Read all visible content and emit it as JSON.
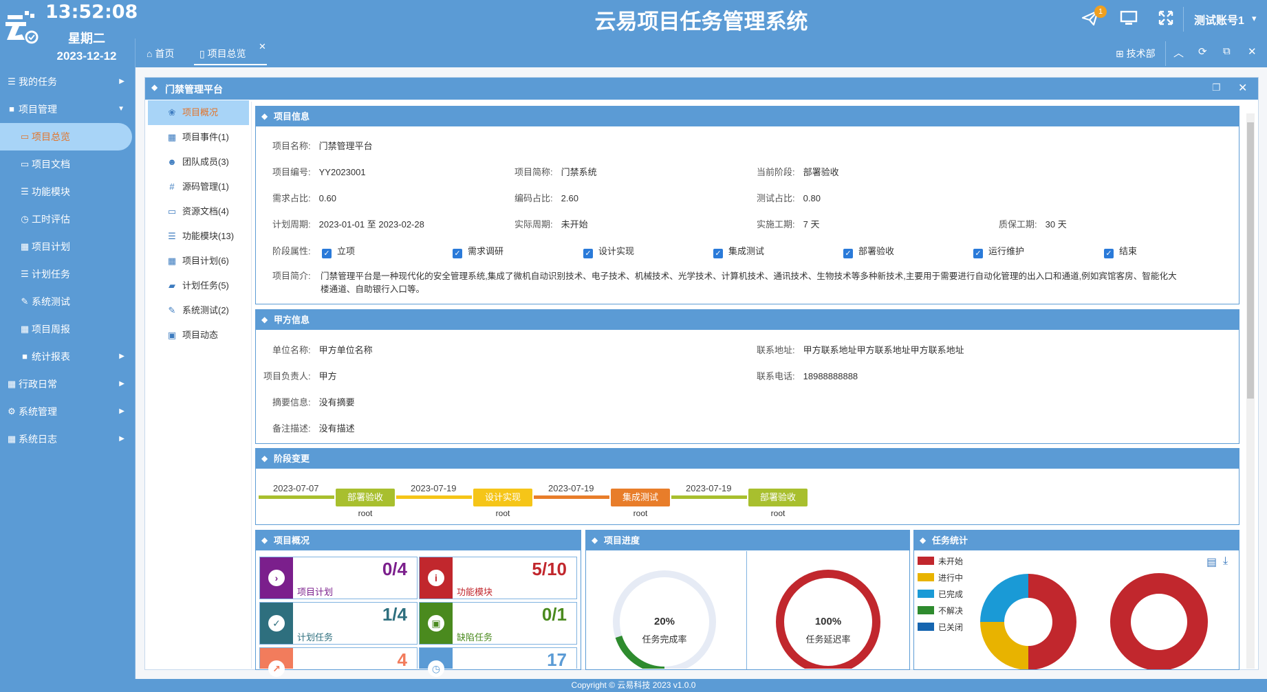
{
  "header": {
    "time": "13:52:08",
    "weekday": "星期二",
    "date": "2023-12-12",
    "title": "云易项目任务管理系统",
    "notification_count": "1",
    "account": "测试账号1"
  },
  "sidebar": {
    "items": [
      {
        "label": "我的任务",
        "icon": "list-icon"
      },
      {
        "label": "项目管理",
        "icon": "folder-icon"
      },
      {
        "label": "项目总览",
        "icon": "folder-open-icon"
      },
      {
        "label": "项目文档",
        "icon": "folder-open-icon"
      },
      {
        "label": "功能模块",
        "icon": "list-icon"
      },
      {
        "label": "工时评估",
        "icon": "clock-icon"
      },
      {
        "label": "项目计划",
        "icon": "calendar-icon"
      },
      {
        "label": "计划任务",
        "icon": "list-icon"
      },
      {
        "label": "系统测试",
        "icon": "pencil-icon"
      },
      {
        "label": "项目周报",
        "icon": "calendar-icon"
      },
      {
        "label": "统计报表",
        "icon": "folder-icon"
      },
      {
        "label": "行政日常",
        "icon": "calendar-check-icon"
      },
      {
        "label": "系统管理",
        "icon": "gears-icon"
      },
      {
        "label": "系统日志",
        "icon": "calendar-icon"
      }
    ]
  },
  "tabs": {
    "home": "首页",
    "overview": "项目总览",
    "department": "技术部"
  },
  "window": {
    "title": "门禁管理平台"
  },
  "inner_nav": [
    {
      "label": "项目概况",
      "icon": "paw-icon"
    },
    {
      "label": "项目事件(1)",
      "icon": "calendar-check-icon"
    },
    {
      "label": "团队成员(3)",
      "icon": "users-icon"
    },
    {
      "label": "源码管理(1)",
      "icon": "hash-icon"
    },
    {
      "label": "资源文档(4)",
      "icon": "folder-open-icon"
    },
    {
      "label": "功能模块(13)",
      "icon": "list-icon"
    },
    {
      "label": "项目计划(6)",
      "icon": "calendar-icon"
    },
    {
      "label": "计划任务(5)",
      "icon": "book-icon"
    },
    {
      "label": "系统测试(2)",
      "icon": "pencil-icon"
    },
    {
      "label": "项目动态",
      "icon": "contact-icon"
    }
  ],
  "project_info": {
    "heading": "项目信息",
    "name_label": "项目名称:",
    "name": "门禁管理平台",
    "code_label": "项目编号:",
    "code": "YY2023001",
    "short_label": "项目简称:",
    "short": "门禁系统",
    "stage_label": "当前阶段:",
    "stage": "部署验收",
    "req_label": "需求占比:",
    "req": "0.60",
    "dev_label": "编码占比:",
    "dev": "2.60",
    "test_label": "测试占比:",
    "test": "0.80",
    "plan_label": "计划周期:",
    "plan": "2023-01-01 至 2023-02-28",
    "actual_label": "实际周期:",
    "actual": "未开始",
    "impl_label": "实施工期:",
    "impl": "7 天",
    "warranty_label": "质保工期:",
    "warranty": "30 天",
    "phase_label": "阶段属性:",
    "phases": [
      "立项",
      "需求调研",
      "设计实现",
      "集成测试",
      "部署验收",
      "运行维护",
      "结束"
    ],
    "intro_label": "项目简介:",
    "intro_line1": "门禁管理平台是一种现代化的安全管理系统,集成了微机自动识别技术、电子技术、机械技术、光学技术、计算机技术、通讯技术、生物技术等多种新技术,主要用于需要进行自动化管理的出入口和通道,例如宾馆客房、智能化大",
    "intro_line2": "楼通道、自助银行入口等。"
  },
  "client_info": {
    "heading": "甲方信息",
    "unit_label": "单位名称:",
    "unit": "甲方单位名称",
    "address_label": "联系地址:",
    "address": "甲方联系地址甲方联系地址甲方联系地址",
    "owner_label": "项目负责人:",
    "owner": "甲方",
    "phone_label": "联系电话:",
    "phone": "18988888888",
    "summary_label": "摘要信息:",
    "summary": "没有摘要",
    "note_label": "备注描述:",
    "note": "没有描述"
  },
  "stage_change": {
    "heading": "阶段变更",
    "steps": [
      {
        "date": "2023-07-07",
        "stage": "部署验收",
        "user": "root",
        "color": "#a8bf2e"
      },
      {
        "date": "2023-07-19",
        "stage": "设计实现",
        "user": "root",
        "color": "#f5c518"
      },
      {
        "date": "2023-07-19",
        "stage": "集成测试",
        "user": "root",
        "color": "#e87d2a"
      },
      {
        "date": "2023-07-19",
        "stage": "部署验收",
        "user": "root",
        "color": "#a8bf2e"
      }
    ]
  },
  "overview": {
    "heading": "项目概况",
    "tiles": [
      {
        "value": "0/4",
        "label": "项目计划",
        "color": "#7b1f8c",
        "icon": "arrow-circle-icon"
      },
      {
        "value": "5/10",
        "label": "功能模块",
        "color": "#c1272d",
        "icon": "info-icon"
      },
      {
        "value": "1/4",
        "label": "计划任务",
        "color": "#2e6f7e",
        "icon": "check-icon"
      },
      {
        "value": "0/1",
        "label": "缺陷任务",
        "color": "#4a8a1e",
        "icon": "address-book-icon"
      },
      {
        "value": "4",
        "label": "",
        "color": "#f27c5c",
        "icon": "share-icon"
      },
      {
        "value": "17",
        "label": "",
        "color": "#5b9bd5",
        "icon": "clock-icon"
      }
    ]
  },
  "progress": {
    "heading": "项目进度",
    "completion_value": "20%",
    "completion_label": "任务完成率",
    "completion_fraction": 0.2,
    "delay_value": "100%",
    "delay_label": "任务延迟率",
    "delay_fraction": 1.0
  },
  "task_stats": {
    "heading": "任务统计",
    "legend": [
      {
        "label": "未开始",
        "color": "#c1272d"
      },
      {
        "label": "进行中",
        "color": "#e8b300"
      },
      {
        "label": "已完成",
        "color": "#1a9ad6"
      },
      {
        "label": "不解决",
        "color": "#2e8b2e"
      },
      {
        "label": "已关闭",
        "color": "#1565b0"
      }
    ]
  },
  "footer": "Copyright © 云易科技 2023 v1.0.0"
}
